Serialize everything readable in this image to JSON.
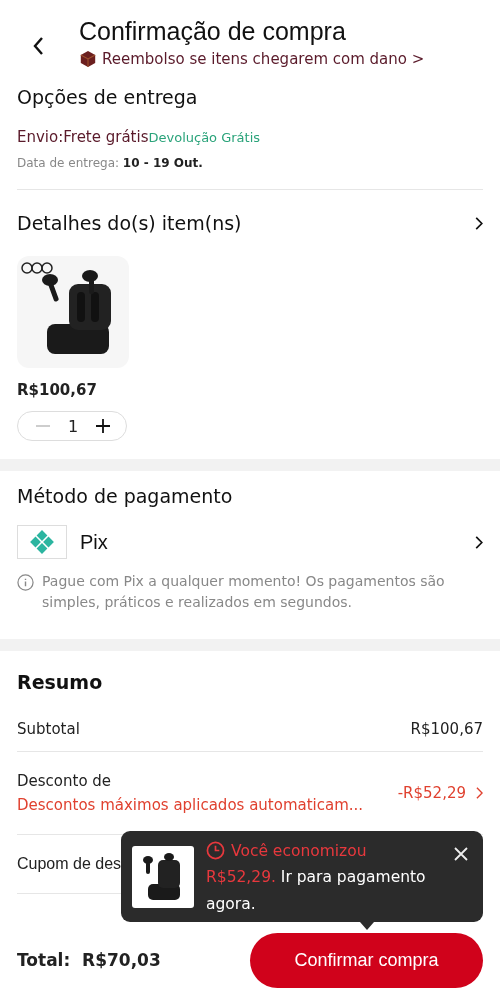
{
  "header": {
    "title": "Confirmação de compra",
    "notice": "Reembolso se itens chegarem com dano >"
  },
  "delivery": {
    "title": "Opções de entrega",
    "shipping": "Envio:Frete grátis",
    "returns": "Devolução Grátis",
    "date_label": "Data de entrega: ",
    "date_value": "10 - 19 Out."
  },
  "items": {
    "title": "Detalhes do(s) item(ns)",
    "products": [
      {
        "kind": "picture",
        "price": "R$100,67",
        "quantity": "1",
        "decrement_disabled": true
      }
    ]
  },
  "payment": {
    "title": "Método de pagamento",
    "method": "Pix",
    "info": "Pague com Pix a qualquer momento! Os pagamentos são simples, práticos e realizados em segundos."
  },
  "summary": {
    "title": "Resumo",
    "rows": [
      {
        "kind": "plain",
        "label": "Subtotal",
        "value": "R$100,67"
      },
      {
        "kind": "discount",
        "label": "Desconto de",
        "detail": "Descontos máximos aplicados automaticam...",
        "value": "-R$52,29"
      },
      {
        "kind": "covered",
        "label": "Cupom de des"
      }
    ]
  },
  "popup": {
    "headline": "Você economizou",
    "amount": "R$52,29.",
    "message": "Ir para pagamento agora."
  },
  "footer": {
    "total_label": "Total:",
    "total": "R$70,03",
    "button": "Confirmar compra"
  }
}
